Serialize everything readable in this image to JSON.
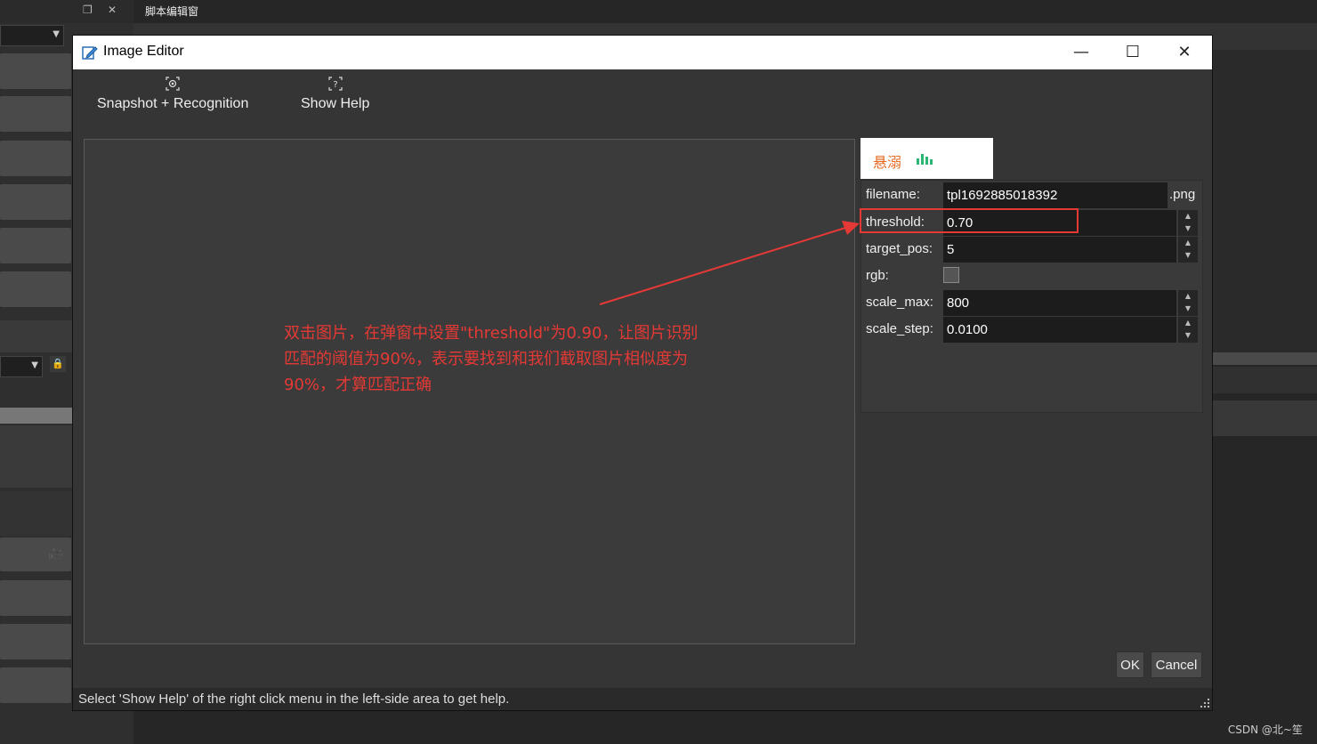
{
  "background": {
    "script_window_title": "脚本编辑窗",
    "float_icon": "❐",
    "close_icon": "✕",
    "lock_icon": "🔒",
    "camera_icon": "🎥"
  },
  "dialog": {
    "title": "Image Editor",
    "window_buttons": {
      "minimize": "—",
      "maximize": "☐",
      "close": "✕"
    },
    "toolbar": {
      "snapshot_label": "Snapshot + Recognition",
      "help_label": "Show Help"
    },
    "preview": {
      "text": "悬溺"
    },
    "properties": {
      "filename": {
        "label": "filename:",
        "value": "tpl1692885018392",
        "suffix": ".png"
      },
      "threshold": {
        "label": "threshold:",
        "value": "0.70"
      },
      "target_pos": {
        "label": "target_pos:",
        "value": "5"
      },
      "rgb": {
        "label": "rgb:",
        "checked": false
      },
      "scale_max": {
        "label": "scale_max:",
        "value": "800"
      },
      "scale_step": {
        "label": "scale_step:",
        "value": "0.0100"
      }
    },
    "buttons": {
      "ok": "OK",
      "cancel": "Cancel"
    },
    "status": "Select 'Show Help' of the right click menu in the left-side area to get help.",
    "annotation": {
      "line1": "双击图片，在弹窗中设置\"threshold\"为0.90，让图片识别",
      "line2": "匹配的阈值为90%，表示要找到和我们截取图片相似度为",
      "line3": "90%，才算匹配正确"
    }
  },
  "watermark": "CSDN @北~笙",
  "colors": {
    "annotation": "#e53935",
    "preview_text": "#e66a22",
    "preview_bars": "#2bb673"
  }
}
